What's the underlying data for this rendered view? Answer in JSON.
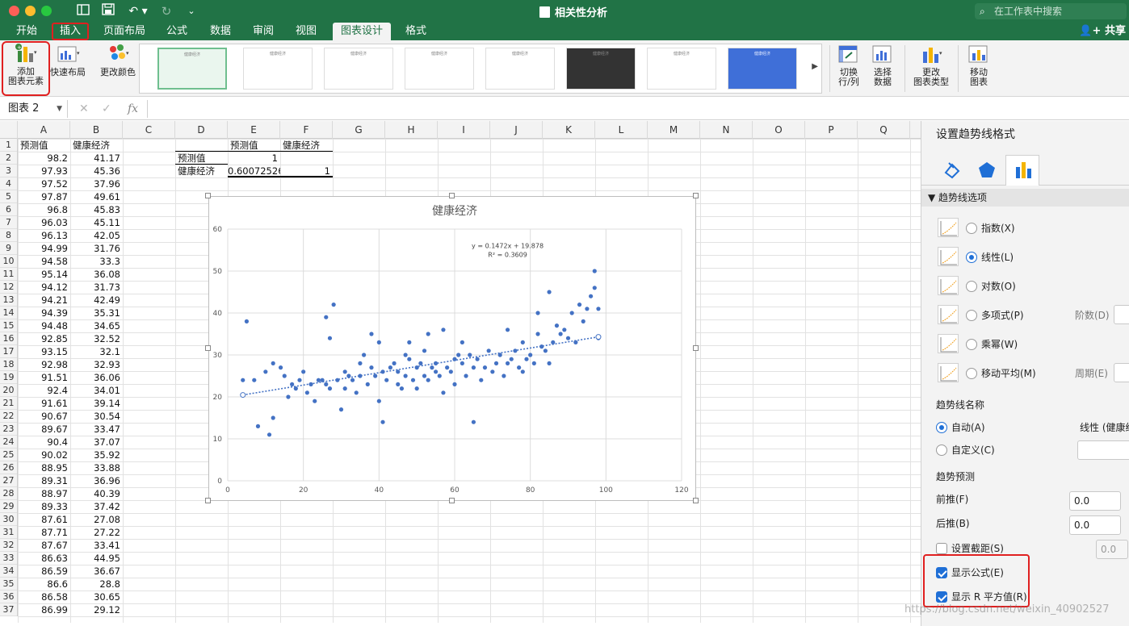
{
  "window": {
    "title": "相关性分析",
    "search_placeholder": "在工作表中搜索",
    "share_label": "共享"
  },
  "tabs": [
    {
      "label": "开始"
    },
    {
      "label": "插入"
    },
    {
      "label": "页面布局"
    },
    {
      "label": "公式"
    },
    {
      "label": "数据"
    },
    {
      "label": "审阅"
    },
    {
      "label": "视图"
    },
    {
      "label": "图表设计"
    },
    {
      "label": "格式"
    }
  ],
  "ribbon": {
    "add_element": "添加\n图表元素",
    "quick_layout": "快速布局",
    "change_color": "更改颜色",
    "gallery_thumb_title": "健康经济",
    "switch_rowcol": "切换\n行/列",
    "select_data": "选择\n数据",
    "change_type": "更改\n图表类型",
    "move_chart": "移动\n图表"
  },
  "formula_bar": {
    "name_box": "图表 2",
    "cancel": "✕",
    "enter": "✓",
    "fx": "fx"
  },
  "columns": [
    "A",
    "B",
    "C",
    "D",
    "E",
    "F",
    "G",
    "H",
    "I",
    "J",
    "K",
    "L",
    "M",
    "N",
    "O",
    "P",
    "Q"
  ],
  "rows": [
    "1",
    "2",
    "3",
    "4",
    "5",
    "6",
    "7",
    "8",
    "9",
    "10",
    "11",
    "12",
    "13",
    "14",
    "15",
    "16",
    "17",
    "18",
    "19",
    "20",
    "21",
    "22",
    "23",
    "24",
    "25",
    "26",
    "27",
    "28",
    "29",
    "30",
    "31",
    "32",
    "33",
    "34",
    "35",
    "36",
    "37"
  ],
  "table": {
    "header_a": "预测值",
    "header_b": "健康经济",
    "a": [
      "98.2",
      "97.93",
      "97.52",
      "97.87",
      "96.8",
      "96.03",
      "96.13",
      "94.99",
      "94.58",
      "95.14",
      "94.12",
      "94.21",
      "94.39",
      "94.48",
      "92.85",
      "93.15",
      "92.98",
      "91.51",
      "92.4",
      "91.61",
      "90.67",
      "89.67",
      "90.4",
      "90.02",
      "88.95",
      "89.31",
      "88.97",
      "89.33",
      "87.61",
      "87.71",
      "87.67",
      "86.63",
      "86.59",
      "86.6",
      "86.58",
      "86.99"
    ],
    "b": [
      "41.17",
      "45.36",
      "37.96",
      "49.61",
      "45.83",
      "45.11",
      "42.05",
      "31.76",
      "33.3",
      "36.08",
      "31.73",
      "42.49",
      "35.31",
      "34.65",
      "32.52",
      "32.1",
      "32.93",
      "36.06",
      "34.01",
      "39.14",
      "30.54",
      "33.47",
      "37.07",
      "35.92",
      "33.88",
      "36.96",
      "40.39",
      "37.42",
      "27.08",
      "27.22",
      "33.41",
      "44.95",
      "36.67",
      "28.8",
      "30.65",
      "29.12"
    ]
  },
  "corr": {
    "h1": "预测值",
    "h2": "健康经济",
    "r1_label": "预测值",
    "r1_v1": "1",
    "r2_label": "健康经济",
    "r2_v1": "0.60072526",
    "r2_v2": "1"
  },
  "chart_data": {
    "type": "scatter",
    "title": "健康经济",
    "xlim": [
      0,
      120
    ],
    "ylim": [
      0,
      60
    ],
    "xticks": [
      "0",
      "20",
      "40",
      "60",
      "80",
      "100",
      "120"
    ],
    "yticks": [
      "0",
      "10",
      "20",
      "30",
      "40",
      "50",
      "60"
    ],
    "grid": true,
    "trendline": {
      "type": "linear",
      "slope": 0.1472,
      "intercept": 19.878,
      "x_range": [
        4,
        98
      ]
    },
    "equation_label": "y = 0.1472x + 19.878",
    "r2_label": "R² = 0.3609",
    "points": [
      [
        4,
        24
      ],
      [
        5,
        38
      ],
      [
        7,
        24
      ],
      [
        8,
        13
      ],
      [
        10,
        26
      ],
      [
        11,
        11
      ],
      [
        12,
        15
      ],
      [
        12,
        28
      ],
      [
        14,
        27
      ],
      [
        15,
        25
      ],
      [
        16,
        20
      ],
      [
        17,
        23
      ],
      [
        18,
        22
      ],
      [
        19,
        24
      ],
      [
        20,
        26
      ],
      [
        21,
        21
      ],
      [
        22,
        23
      ],
      [
        23,
        19
      ],
      [
        24,
        24
      ],
      [
        25,
        24
      ],
      [
        26,
        23
      ],
      [
        26,
        39
      ],
      [
        27,
        22
      ],
      [
        27,
        34
      ],
      [
        28,
        42
      ],
      [
        29,
        24
      ],
      [
        30,
        17
      ],
      [
        31,
        26
      ],
      [
        31,
        22
      ],
      [
        32,
        25
      ],
      [
        33,
        24
      ],
      [
        34,
        21
      ],
      [
        35,
        28
      ],
      [
        35,
        25
      ],
      [
        36,
        30
      ],
      [
        37,
        23
      ],
      [
        38,
        27
      ],
      [
        38,
        35
      ],
      [
        39,
        25
      ],
      [
        40,
        33
      ],
      [
        40,
        19
      ],
      [
        41,
        26
      ],
      [
        41,
        14
      ],
      [
        42,
        24
      ],
      [
        43,
        27
      ],
      [
        44,
        28
      ],
      [
        45,
        26
      ],
      [
        45,
        23
      ],
      [
        46,
        22
      ],
      [
        47,
        25
      ],
      [
        47,
        30
      ],
      [
        48,
        33
      ],
      [
        48,
        29
      ],
      [
        49,
        24
      ],
      [
        50,
        27
      ],
      [
        50,
        22
      ],
      [
        51,
        28
      ],
      [
        52,
        31
      ],
      [
        52,
        25
      ],
      [
        53,
        24
      ],
      [
        53,
        35
      ],
      [
        54,
        27
      ],
      [
        55,
        26
      ],
      [
        55,
        28
      ],
      [
        56,
        25
      ],
      [
        57,
        21
      ],
      [
        57,
        36
      ],
      [
        58,
        27
      ],
      [
        59,
        26
      ],
      [
        60,
        29
      ],
      [
        60,
        23
      ],
      [
        61,
        30
      ],
      [
        62,
        28
      ],
      [
        62,
        33
      ],
      [
        63,
        25
      ],
      [
        64,
        30
      ],
      [
        65,
        27
      ],
      [
        65,
        14
      ],
      [
        66,
        29
      ],
      [
        67,
        24
      ],
      [
        68,
        27
      ],
      [
        69,
        31
      ],
      [
        70,
        26
      ],
      [
        71,
        28
      ],
      [
        72,
        30
      ],
      [
        73,
        25
      ],
      [
        74,
        36
      ],
      [
        74,
        28
      ],
      [
        75,
        29
      ],
      [
        76,
        31
      ],
      [
        77,
        27
      ],
      [
        78,
        33
      ],
      [
        78,
        26
      ],
      [
        79,
        29
      ],
      [
        80,
        30
      ],
      [
        81,
        28
      ],
      [
        82,
        35
      ],
      [
        82,
        40
      ],
      [
        83,
        32
      ],
      [
        84,
        31
      ],
      [
        85,
        45
      ],
      [
        85,
        28
      ],
      [
        86,
        33
      ],
      [
        87,
        37
      ],
      [
        88,
        35
      ],
      [
        89,
        36
      ],
      [
        90,
        34
      ],
      [
        91,
        40
      ],
      [
        92,
        33
      ],
      [
        93,
        42
      ],
      [
        94,
        38
      ],
      [
        95,
        41
      ],
      [
        96,
        44
      ],
      [
        97,
        46
      ],
      [
        97,
        50
      ],
      [
        98,
        41
      ],
      [
        98,
        34
      ]
    ]
  },
  "pane": {
    "title": "设置趋势线格式",
    "section": "趋势线选项",
    "opt_exp": "指数(X)",
    "opt_linear": "线性(L)",
    "opt_log": "对数(O)",
    "opt_poly": "多项式(P)",
    "opt_power": "乘幂(W)",
    "opt_ma": "移动平均(M)",
    "order_label": "阶数(D)",
    "period_label": "周期(E)",
    "name_header": "趋势线名称",
    "auto_label": "自动(A)",
    "auto_value": "线性 (健康经",
    "custom_label": "自定义(C)",
    "forecast_header": "趋势预测",
    "forward_label": "前推(F)",
    "forward_value": "0.0",
    "backward_label": "后推(B)",
    "backward_value": "0.0",
    "intercept_label": "设置截距(S)",
    "intercept_value": "0.0",
    "show_eq_label": "显示公式(E)",
    "show_r2_label": "显示 R 平方值(R)"
  },
  "watermark": "https://blog.csdn.net/weixin_40902527"
}
